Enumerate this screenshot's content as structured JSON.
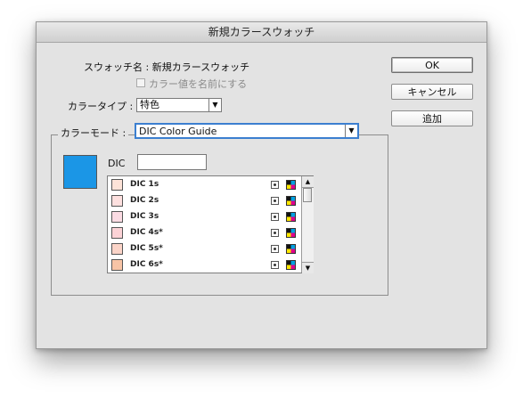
{
  "dialog": {
    "title": "新規カラースウォッチ",
    "swatch_name_label": "スウォッチ名 : 新規カラースウォッチ",
    "checkbox_label": "カラー値を名前にする",
    "color_type_label": "カラータイプ :",
    "color_type_value": "特色",
    "color_mode_label": "カラーモード :",
    "color_mode_value": "DIC Color Guide",
    "dic_label": "DIC",
    "dic_value": ""
  },
  "buttons": {
    "ok": "OK",
    "cancel": "キャンセル",
    "add": "追加"
  },
  "preview_color": "#1b96e6",
  "swatches": [
    {
      "name": "DIC 1s",
      "color": "#fde3d8"
    },
    {
      "name": "DIC 2s",
      "color": "#fde0df"
    },
    {
      "name": "DIC 3s",
      "color": "#fbdbe3"
    },
    {
      "name": "DIC 4s*",
      "color": "#fbd2d6"
    },
    {
      "name": "DIC 5s*",
      "color": "#fbd4c8"
    },
    {
      "name": "DIC 6s*",
      "color": "#f7c4a6"
    }
  ]
}
